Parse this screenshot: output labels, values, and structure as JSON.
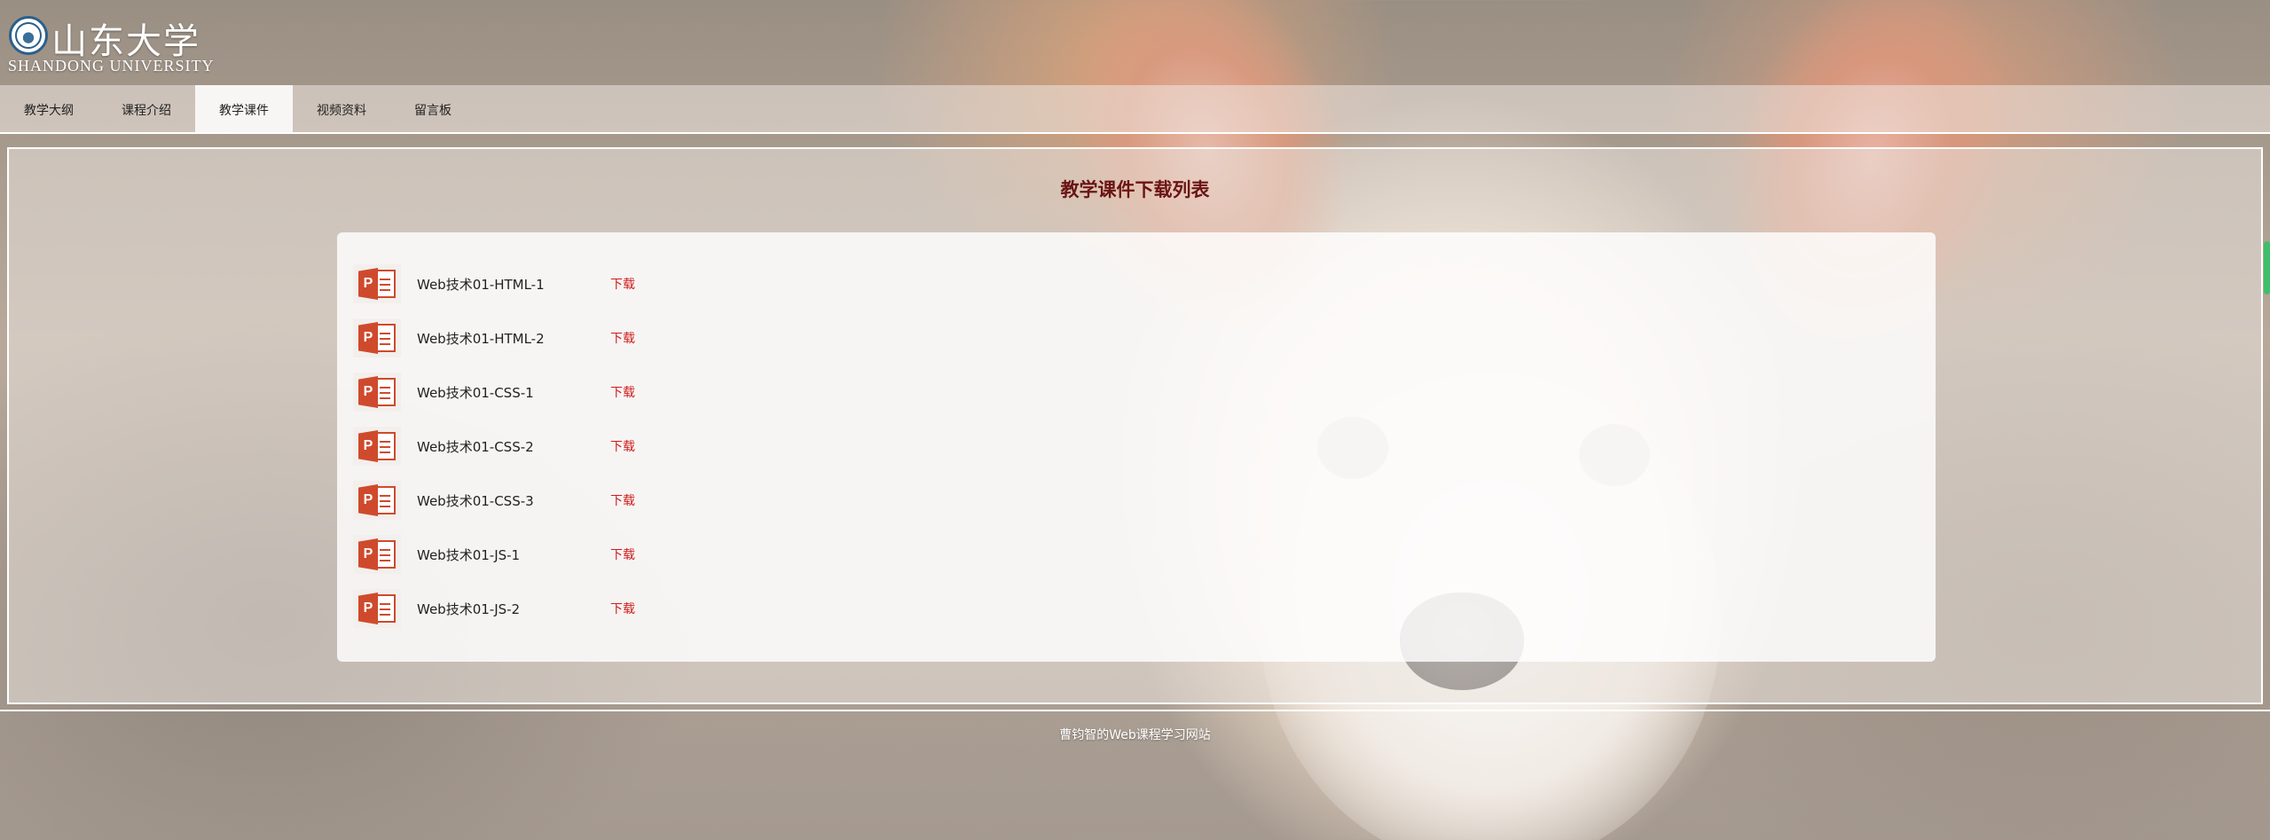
{
  "logo": {
    "cn": "山东大学",
    "en": "SHANDONG UNIVERSITY",
    "emblem": "university-emblem-icon"
  },
  "nav": {
    "items": [
      {
        "label": "教学大纲",
        "active": false
      },
      {
        "label": "课程介绍",
        "active": false
      },
      {
        "label": "教学课件",
        "active": true
      },
      {
        "label": "视频资料",
        "active": false
      },
      {
        "label": "留言板",
        "active": false
      }
    ]
  },
  "main": {
    "title": "教学课件下载列表",
    "files": [
      {
        "name": "Web技术01-HTML-1",
        "action": "下载",
        "icon": "powerpoint-icon"
      },
      {
        "name": "Web技术01-HTML-2",
        "action": "下载",
        "icon": "powerpoint-icon"
      },
      {
        "name": "Web技术01-CSS-1",
        "action": "下载",
        "icon": "powerpoint-icon"
      },
      {
        "name": "Web技术01-CSS-2",
        "action": "下载",
        "icon": "powerpoint-icon"
      },
      {
        "name": "Web技术01-CSS-3",
        "action": "下载",
        "icon": "powerpoint-icon"
      },
      {
        "name": "Web技术01-JS-1",
        "action": "下载",
        "icon": "powerpoint-icon"
      },
      {
        "name": "Web技术01-JS-2",
        "action": "下载",
        "icon": "powerpoint-icon"
      }
    ]
  },
  "footer": {
    "text": "曹钧智的Web课程学习网站"
  },
  "colors": {
    "title": "#6b1414",
    "download_link": "#d01c1c",
    "ppt_icon": "#cf4a2c",
    "scrollbar": "#3fbf6b"
  }
}
